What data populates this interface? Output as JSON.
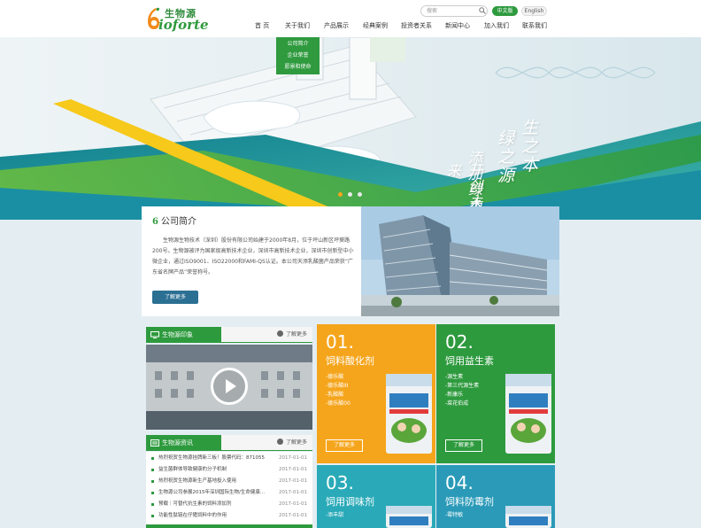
{
  "header": {
    "logo_cn": "生物源",
    "logo_en": "ioforte",
    "search_placeholder": "搜索",
    "lang_cn": "中文版",
    "lang_en": "English",
    "nav": [
      "首 页",
      "关于我们",
      "产品展示",
      "经典案例",
      "投资者关系",
      "新闻中心",
      "加入我们",
      "联系我们"
    ]
  },
  "dropdown": [
    "公司简介",
    "企业荣誉",
    "愿景和使命"
  ],
  "banner": {
    "line1": "生之本",
    "line2": "绿之源",
    "line3": "添加绿色",
    "line4": "开创未来"
  },
  "intro": {
    "title": "公司简介",
    "text": "生物源生物技术（深圳）股份有限公司始建于2000年8月，位于坪山新区坪葵路200号。生物源被评为国家级高新技术企业，深圳市高新技术企业，深圳市创新型中小微企业，通过ISO9001、ISO22000和FAMI-QS认证。本公司天添乳酸菌产品荣获“广东省名牌产品”荣誉称号。",
    "more": "了解更多"
  },
  "video_panel": {
    "title": "生物源印象",
    "more": "了解更多"
  },
  "news_panel": {
    "title": "生物源资讯",
    "more": "了解更多",
    "items": [
      {
        "title": "热烈祝贺生物源挂牌新三板！股票代码：871055",
        "date": "2017-01-01"
      },
      {
        "title": "益生菌群体导致健康的分子机制",
        "date": "2017-01-01"
      },
      {
        "title": "热烈祝贺生物源新生产基地投入使用",
        "date": "2017-01-01"
      },
      {
        "title": "生物源公司参展2015年深圳国际生物/生命健康...",
        "date": "2017-01-01"
      },
      {
        "title": "预载｜可替代抗生素的饲料添加剂",
        "date": "2017-01-01"
      },
      {
        "title": "功能性肽链在仔猪饲料中的作用",
        "date": "2017-01-01"
      }
    ]
  },
  "products": [
    {
      "num": "01.",
      "name": "饲料酸化剂",
      "features": [
        "-德乐酸",
        "-德乐酸III",
        "-乳酸酸",
        "-德乐酸00"
      ],
      "more": "了解更多",
      "color": "#f5a51c"
    },
    {
      "num": "02.",
      "name": "饲用益生素",
      "features": [
        "-源生素",
        "-第三代源生素",
        "-新康乐",
        "-菜花伯成"
      ],
      "more": "了解更多",
      "color": "#2e9a3e"
    },
    {
      "num": "03.",
      "name": "饲用调味剂",
      "features": [
        "-添丰甜"
      ],
      "more": "",
      "color": "#2aaab8"
    },
    {
      "num": "04.",
      "name": "饲料防霉剂",
      "features": [
        "-霉特敏"
      ],
      "more": "",
      "color": "#2a9ab8"
    }
  ],
  "colors": {
    "green": "#2e9a3e",
    "blue": "#2b6f93",
    "orange": "#f5a51c",
    "teal": "#2aaab8"
  }
}
